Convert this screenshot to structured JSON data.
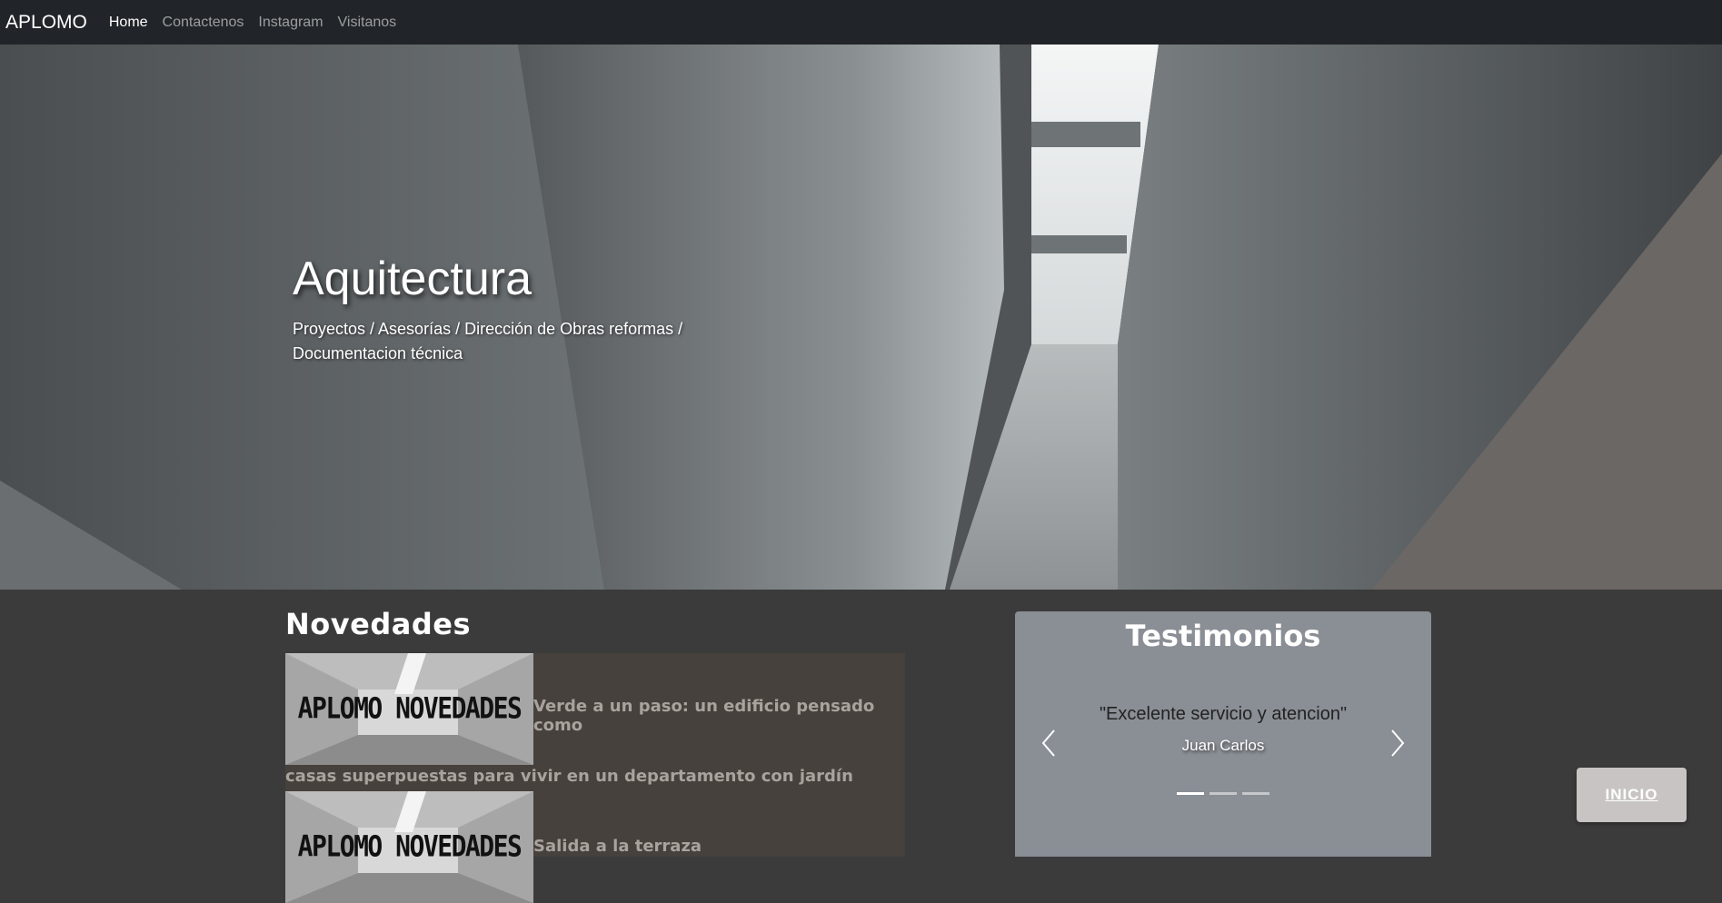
{
  "navbar": {
    "brand": "APLOMO",
    "links": [
      "Home",
      "Contactenos",
      "Instagram",
      "Visitanos"
    ]
  },
  "hero": {
    "title": "Aquitectura",
    "subtitle": "Proyectos / Asesorías / Dirección de Obras reformas / Documentacion técnica"
  },
  "novedades": {
    "title": "Novedades",
    "thumb_label": "APLOMO NOVEDADES",
    "items": [
      {
        "text_part1": "Verde a un paso: un edificio pensado como",
        "text_part2": "casas superpuestas para vivir en un departamento con jardín"
      },
      {
        "text_part1": "Salida a la terraza",
        "text_part2": ""
      }
    ]
  },
  "testimonios": {
    "title": "Testimonios",
    "quote": "\"Excelente servicio y atencion\"",
    "author": "Juan Carlos",
    "indicator_count": 3,
    "active_indicator": 0
  },
  "inicio_button": "INICIO",
  "colors": {
    "navbar_bg": "#212529",
    "page_bg": "#3b3b3b",
    "testimonios_bg": "#8a8e95",
    "novedades_panel": "#46413c"
  }
}
